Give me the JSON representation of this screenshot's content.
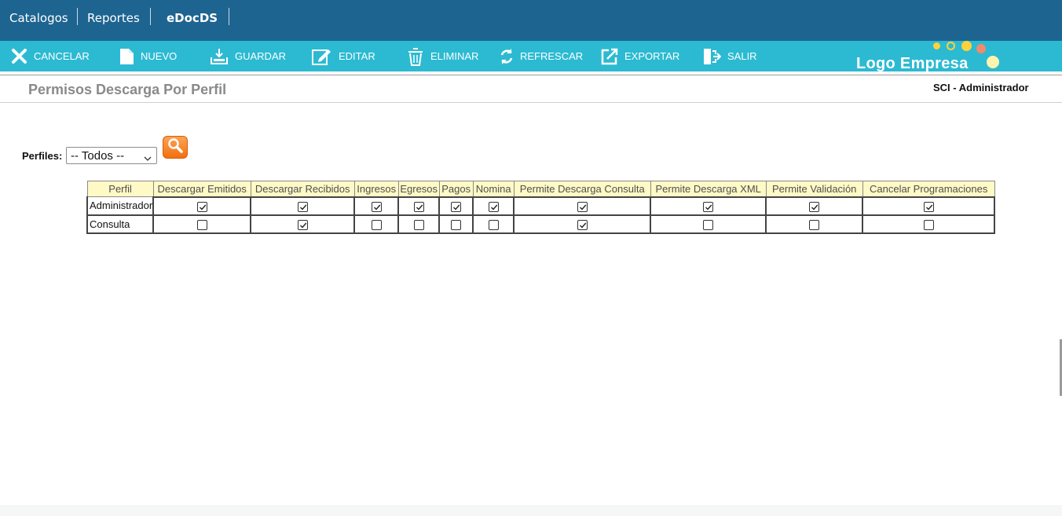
{
  "menu": {
    "items": [
      {
        "label": "Catalogos"
      },
      {
        "label": "Reportes"
      },
      {
        "label": "eDocDS"
      }
    ]
  },
  "toolbar": {
    "cancel_label": "CANCELAR",
    "new_label": "NUEVO",
    "save_label": "GUARDAR",
    "edit_label": "EDITAR",
    "delete_label": "ELIMINAR",
    "refresh_label": "REFRESCAR",
    "export_label": "EXPORTAR",
    "exit_label": "SALIR"
  },
  "logo": {
    "text": "Logo Empresa",
    "dot_colors": [
      "#ffd23c",
      "#ffd23c",
      "#ffd23c",
      "#f08a6e",
      "#fff3b0"
    ]
  },
  "page": {
    "title": "Permisos Descarga Por Perfil",
    "user": "SCI - Administrador"
  },
  "filter": {
    "label": "Perfiles:",
    "selected": "-- Todos --"
  },
  "table": {
    "headers": [
      "Perfil",
      "Descargar Emitidos",
      "Descargar Recibidos",
      "Ingresos",
      "Egresos",
      "Pagos",
      "Nomina",
      "Permite Descarga Consulta",
      "Permite Descarga XML",
      "Permite Validación",
      "Cancelar Programaciones"
    ],
    "rows": [
      {
        "name": "Administrador",
        "values": [
          true,
          true,
          true,
          true,
          true,
          true,
          true,
          true,
          true,
          true
        ]
      },
      {
        "name": "Consulta",
        "values": [
          false,
          true,
          false,
          false,
          false,
          false,
          true,
          false,
          false,
          false
        ]
      }
    ]
  },
  "colors": {
    "topbar": "#1e6490",
    "toolbar": "#2cbad2",
    "header_bg": "#fff9c6",
    "search_button": "#f7851f"
  }
}
